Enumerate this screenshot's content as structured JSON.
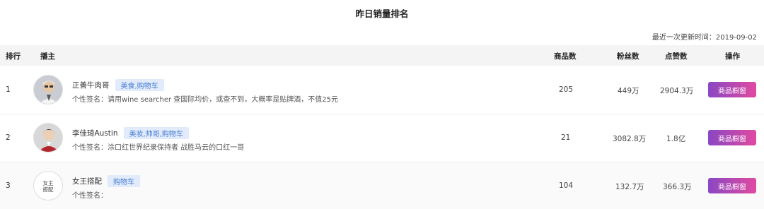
{
  "title": "昨日销量排名",
  "updated": "最近一次更新时间：2019-09-02",
  "headers": {
    "rank": "排行",
    "anchor": "播主",
    "goods": "商品数",
    "fans": "粉丝数",
    "likes": "点赞数",
    "action": "操作"
  },
  "rows": [
    {
      "rank": "1",
      "name": "正善牛肉哥",
      "tag": "美食,购物车",
      "signature": "个性签名：请用wine searcher 查国际均价，或查不到，大概率是贴牌酒，不值25元",
      "goods": "205",
      "fans": "449万",
      "likes": "2904.3万",
      "button": "商品橱窗",
      "avatar_icon": "person-avatar-icon"
    },
    {
      "rank": "2",
      "name": "李佳琦Austin",
      "tag": "美妆,帅哥,购物车",
      "signature": "个性签名：涂口红世界纪录保持者 战胜马云的口红一哥",
      "goods": "21",
      "fans": "3082.8万",
      "likes": "1.8亿",
      "button": "商品橱窗",
      "avatar_icon": "person-avatar-icon"
    },
    {
      "rank": "3",
      "name": "女王搭配",
      "tag": "购物车",
      "signature": "个性签名：",
      "goods": "104",
      "fans": "132.7万",
      "likes": "366.3万",
      "button": "商品橱窗",
      "avatar_text": "女王\n搭配"
    }
  ]
}
